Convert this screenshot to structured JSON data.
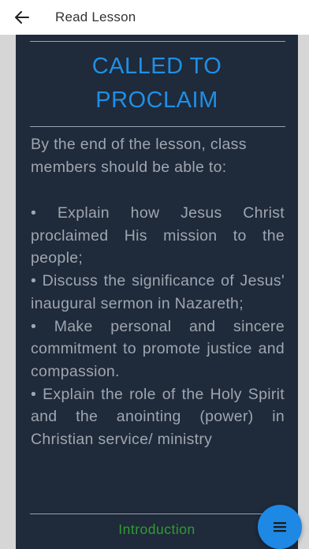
{
  "app_bar": {
    "title": "Read Lesson",
    "back_icon": "arrow-left-icon"
  },
  "lesson": {
    "heading_line1": "CALLED TO",
    "heading_line2": "PROCLAIM",
    "intro": "By the end of the lesson, class members should be able to:",
    "objectives": [
      "• Explain how Jesus Christ proclaimed His mission to the people;",
      "• Discuss the significance of Jesus' inaugural sermon in Nazareth;",
      "• Make personal and sincere commitment to promote justice and compassion.",
      "• Explain the role of the Holy Spirit and the anointing (power) in Christian service/ ministry"
    ],
    "section_label": "Introduction"
  },
  "fab": {
    "icon": "menu-icon"
  },
  "colors": {
    "card_bg": "#1f2a3a",
    "heading": "#1e90e6",
    "body_text": "#a0a6b0",
    "section_label": "#2f9e2f",
    "fab": "#1e88e5"
  }
}
